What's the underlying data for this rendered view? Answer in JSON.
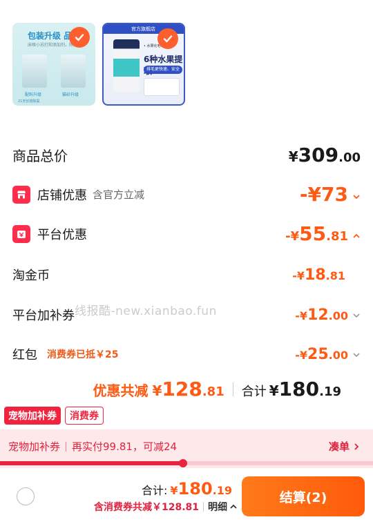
{
  "products": [
    {
      "title": "包装升级 品质",
      "subtitle": "床嗅小苏打和添加剂，除臭",
      "tag_left": "配料升级",
      "tag_right": "猫砂升级",
      "footer": "21天长效除臭",
      "selected": true
    },
    {
      "header": "官方旗舰店",
      "note": "• 水果化毛球",
      "title": "6种水果提取",
      "pill": "排毛更快速、安全",
      "selected": true
    }
  ],
  "totals": {
    "goods_total_label": "商品总价",
    "goods_total_sym": "¥",
    "goods_total_int": "309",
    "goods_total_dec": ".00",
    "store_discount_label": "店铺优惠",
    "store_discount_sub": "含官方立减",
    "store_discount_value": "-¥73",
    "platform_discount_label": "平台优惠",
    "platform_discount_sym": "-¥",
    "platform_discount_int": "55",
    "platform_discount_dec": ".81",
    "coins_label": "淘金币",
    "coins_sym": "-¥",
    "coins_int": "18",
    "coins_dec": ".81",
    "subsidy_label": "平台加补券",
    "subsidy_sym": "-¥",
    "subsidy_int": "12",
    "subsidy_dec": ".00",
    "redpacket_label": "红包",
    "redpacket_sub": "消费券已抵￥25",
    "redpacket_sym": "-¥",
    "redpacket_int": "25",
    "redpacket_dec": ".00",
    "discount_total_label": "优惠共减",
    "discount_total_sym": "¥",
    "discount_total_int": "128",
    "discount_total_dec": ".81",
    "sum_label": "合计",
    "sum_sym": "¥",
    "sum_int": "180",
    "sum_dec": ".19"
  },
  "watermark": "线报酷-new.xianbao.fun",
  "coupon_tags": [
    "宠物加补券",
    "消费券"
  ],
  "promo": {
    "name": "宠物加补券",
    "message": "再实付99.81，可减24",
    "link_label": "凑单",
    "progress": 0.49
  },
  "bottom": {
    "total_label": "合计:",
    "total_sym": "¥",
    "total_int": "180",
    "total_dec": ".19",
    "coupon_saving": "含消费券共减￥128.81",
    "detail_label": "明细",
    "checkout_label": "结算(2)"
  },
  "colors": {
    "accent": "#ff5a14",
    "red": "#f0243f",
    "promo_bg": "#fde8ea"
  }
}
